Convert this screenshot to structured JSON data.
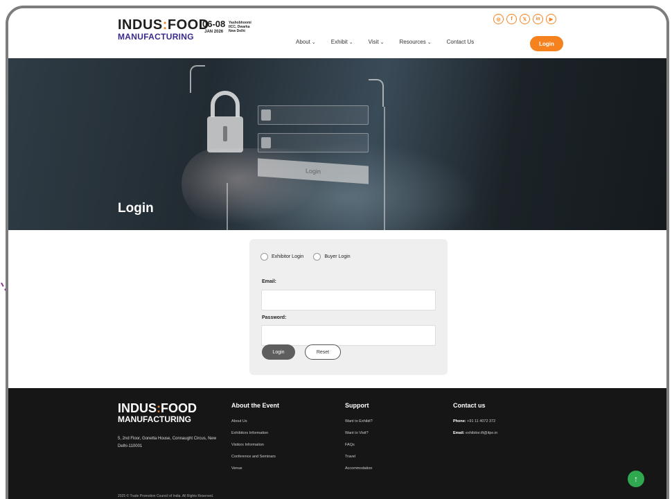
{
  "header": {
    "logo_top_a": "INDUS",
    "logo_top_colon": ":",
    "logo_top_b": "FOOD",
    "logo_bottom": "MANUFACTURING",
    "date_days": "06-08",
    "date_month": "JAN 2026",
    "venue_line1": "Yashobhoomi",
    "venue_line2": "IICC, Dwarka",
    "venue_line3": "New Delhi",
    "socials": [
      "instagram-icon",
      "facebook-icon",
      "x-icon",
      "linkedin-icon",
      "youtube-icon"
    ],
    "social_glyphs": [
      "◎",
      "f",
      "𝕏",
      "in",
      "▶"
    ],
    "nav": [
      {
        "label": "About",
        "chevron": "⌄"
      },
      {
        "label": "Exhibit",
        "chevron": "⌄"
      },
      {
        "label": "Visit",
        "chevron": "⌄"
      },
      {
        "label": "Resources",
        "chevron": "⌄"
      },
      {
        "label": "Contact Us",
        "chevron": ""
      }
    ],
    "login_label": "Login"
  },
  "hero": {
    "title": "Login",
    "ghost_login_label": "Login"
  },
  "form": {
    "radio_exhibitor": "Exhibitor Login",
    "radio_buyer": "Buyer Login",
    "email_label": "Email:",
    "email_value": "",
    "password_label": "Password:",
    "password_value": "",
    "login_button": "Login",
    "reset_button": "Reset"
  },
  "footer": {
    "logo_a": "INDUS",
    "logo_colon": ":",
    "logo_b": "FOOD",
    "logo_bottom": "MANUFACTURING",
    "address": "5, 2nd Floor, Gonetta House, Connaught Circus, New Delhi-110001",
    "about": {
      "heading": "About the Event",
      "links": [
        "About Us",
        "Exhibitors Information",
        "Visitors Information",
        "Conference and Seminars",
        "Venue"
      ]
    },
    "support": {
      "heading": "Support",
      "links": [
        "Want to Exhibit?",
        "Want to Visit?",
        "FAQs",
        "Travel",
        "Accommodation"
      ]
    },
    "contact": {
      "heading": "Contact us",
      "phone_label": "Phone:",
      "phone_value": "+91 11 4072 372",
      "email_label": "Email:",
      "email_value": "exhibitor.ifi@itpo.in"
    },
    "copyright": "2025 © Trade Promotion Council of India. All Rights Reserved.",
    "scroll_top_glyph": "↑"
  },
  "colors": {
    "accent": "#f5821f",
    "brand_purple": "#3a2a8e",
    "annotation_arrow": "#8e2f8f",
    "scroll_top": "#2fa84f",
    "footer_bg": "#161616"
  }
}
